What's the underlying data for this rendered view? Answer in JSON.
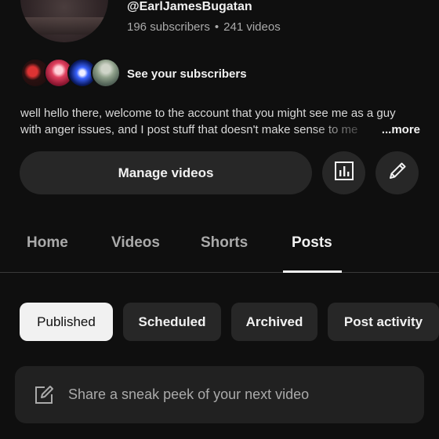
{
  "channel": {
    "handle": "@EarlJamesBugatan",
    "subscribers": "196 subscribers",
    "separator": "•",
    "videos": "241 videos",
    "see_subscribers": "See your subscribers",
    "description_line1": "well hello there, welcome to the account that you might see me as a guy",
    "description_line2": "with anger issues, and I post stuff that doesn't make sense to me",
    "more_label": "...more"
  },
  "actions": {
    "manage_videos": "Manage videos",
    "analytics_icon": "analytics-icon",
    "edit_icon": "pencil-icon"
  },
  "tabs": [
    {
      "label": "Home"
    },
    {
      "label": "Videos"
    },
    {
      "label": "Shorts"
    },
    {
      "label": "Posts",
      "active": true
    }
  ],
  "filters": [
    {
      "label": "Published",
      "active": true
    },
    {
      "label": "Scheduled"
    },
    {
      "label": "Archived"
    },
    {
      "label": "Post activity"
    }
  ],
  "composer": {
    "icon": "compose-icon",
    "placeholder": "Share a sneak peek of your next video"
  },
  "colors": {
    "background": "#0f0f0f",
    "surface": "#272727",
    "text_primary": "#f1f1f1",
    "text_secondary": "#aaaaaa"
  }
}
